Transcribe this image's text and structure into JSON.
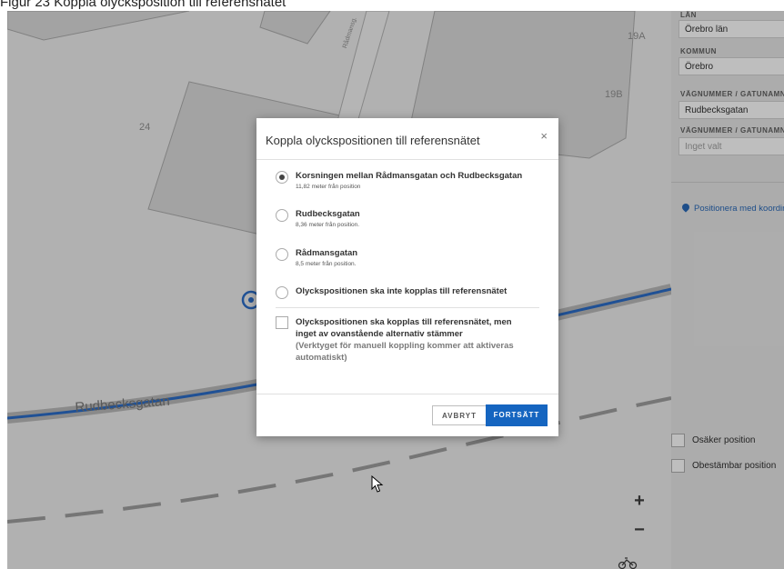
{
  "caption": "Figur 23 Koppla olycksposition till referensnätet",
  "map": {
    "labels": {
      "house_24": "24",
      "house_19a": "19A",
      "house_19b": "19B",
      "street": "Rudbecksgatan",
      "street_small": "Rådmansg."
    },
    "zoom_in": "+",
    "zoom_out": "−"
  },
  "sidebar": {
    "lan_label": "LÄN",
    "lan_value": "Örebro län",
    "kommun_label": "KOMMUN",
    "kommun_value": "Örebro",
    "vagnummer_label": "VÄGNUMMER / GATUNAMN",
    "vagnummer_value": "Rudbecksgatan",
    "vagnummer2_label": "VÄGNUMMER / GATUNAMN",
    "vagnummer2_placeholder": "Inget valt",
    "positionera_link": "Positionera med koordinat",
    "osaker_label": "Osäker position",
    "obestambar_label": "Obestämbar position"
  },
  "dialog": {
    "title": "Koppla olyckspositionen till referensnätet",
    "close": "×",
    "options": [
      {
        "label": "Korsningen mellan Rådmansgatan och Rudbecksgatan",
        "sub": "11,82 meter från position",
        "selected": true
      },
      {
        "label": "Rudbecksgatan",
        "sub": "8,36 meter från position.",
        "selected": false
      },
      {
        "label": "Rådmansgatan",
        "sub": "8,5 meter från position.",
        "selected": false
      },
      {
        "label": "Olyckspositionen ska inte kopplas till referensnätet",
        "sub": "",
        "selected": false
      }
    ],
    "checkbox_label": "Olyckspositionen ska kopplas till referensnätet, men inget av ovanstående alternativ stämmer",
    "checkbox_note": "(Verktyget för manuell koppling kommer att aktiveras automatiskt)",
    "checkbox_checked": false,
    "cancel_label": "AVBRYT",
    "continue_label": "FORTSÄTT"
  },
  "colors": {
    "primary": "#1565c0",
    "road_blue": "#1e63c4",
    "map_bg": "#ececec"
  }
}
